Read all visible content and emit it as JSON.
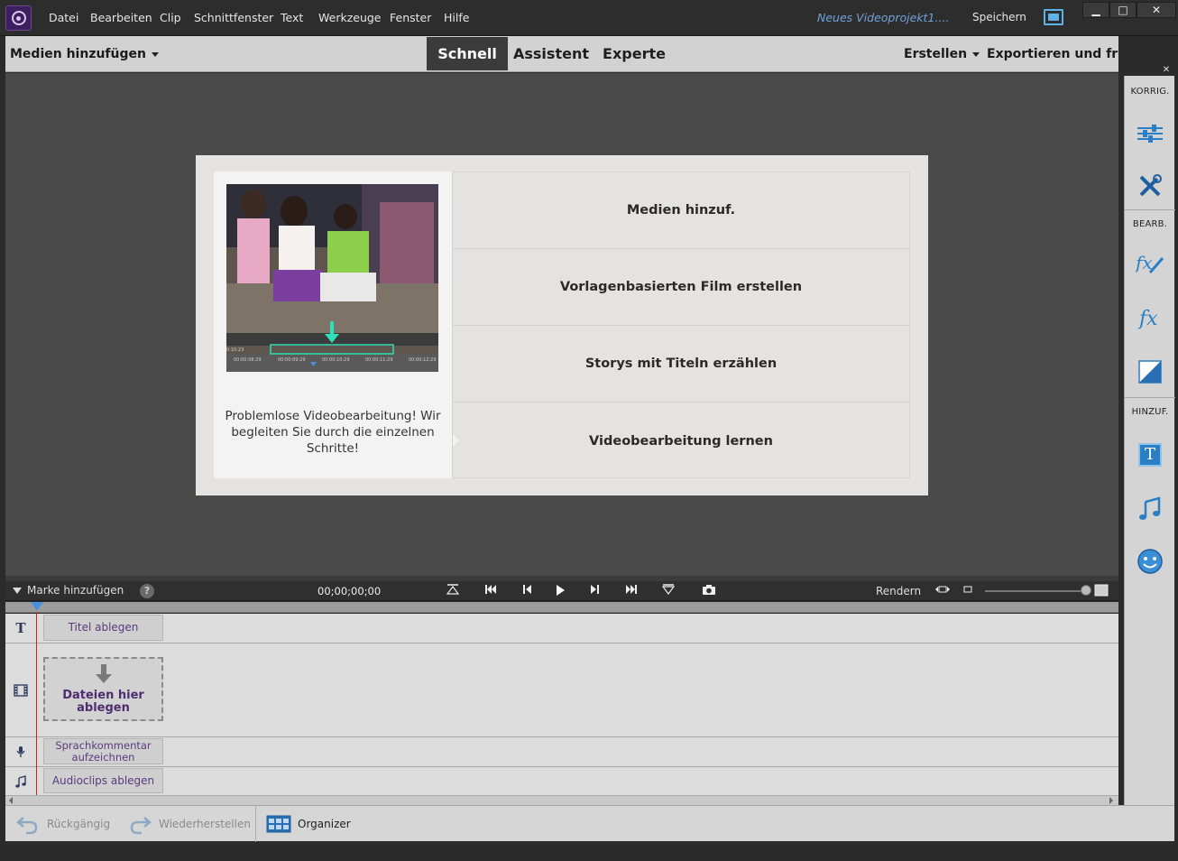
{
  "menubar": {
    "items": [
      "Datei",
      "Bearbeiten",
      "Clip",
      "Schnittfenster",
      "Text",
      "Werkzeuge",
      "Fenster",
      "Hilfe"
    ],
    "project_title": "Neues Videoprojekt1....",
    "save_label": "Speichern",
    "window_controls": {
      "minimize": "▁",
      "maximize": "□",
      "close": "✕"
    }
  },
  "toolbar": {
    "add_media_label": "Medien hinzufügen",
    "modes": [
      {
        "label": "Schnell",
        "active": true
      },
      {
        "label": "Assistent",
        "active": false
      },
      {
        "label": "Experte",
        "active": false
      }
    ],
    "create_label": "Erstellen",
    "export_label": "Exportieren und freige"
  },
  "welcome": {
    "description": "Problemlose Videobearbeitung! Wir begleiten Sie durch die einzelnen Schritte!",
    "options": [
      "Medien hinzuf.",
      "Vorlagenbasierten Film erstellen",
      "Storys mit Titeln erzählen",
      "Videobearbeitung lernen"
    ],
    "thumb_timecodes": [
      "0:10:23",
      "00:00:08:29",
      "00:00:09:29",
      "00:00:10:29",
      "00:00:11:29",
      "00:00:12:29"
    ]
  },
  "right_panel": {
    "close_label": "✕",
    "sections": [
      "KORRIG.",
      "BEARB.",
      "HINZUF."
    ],
    "icons": [
      "adjust-icon",
      "tools-icon",
      "fx-edit-icon",
      "fx-icon",
      "transition-icon",
      "title-icon",
      "music-icon",
      "graphics-icon"
    ],
    "title_glyph": "T"
  },
  "timeline": {
    "add_marker_label": "Marke hinzufügen",
    "help_label": "?",
    "timecode": "00;00;00;00",
    "render_label": "Rendern",
    "tracks": {
      "title_slot": "Titel ablegen",
      "drop_zone": "Dateien hier ablegen",
      "narration_slot": "Sprachkommentar aufzeichnen",
      "audio_slot": "Audioclips ablegen"
    }
  },
  "bottom_bar": {
    "undo_label": "Rückgängig",
    "redo_label": "Wiederherstellen",
    "organizer_label": "Organizer"
  },
  "colors": {
    "accent_blue": "#4a90d9",
    "project_title": "#6fa3d9",
    "playhead": "#d42020",
    "slot_text": "#5a3a7e"
  }
}
